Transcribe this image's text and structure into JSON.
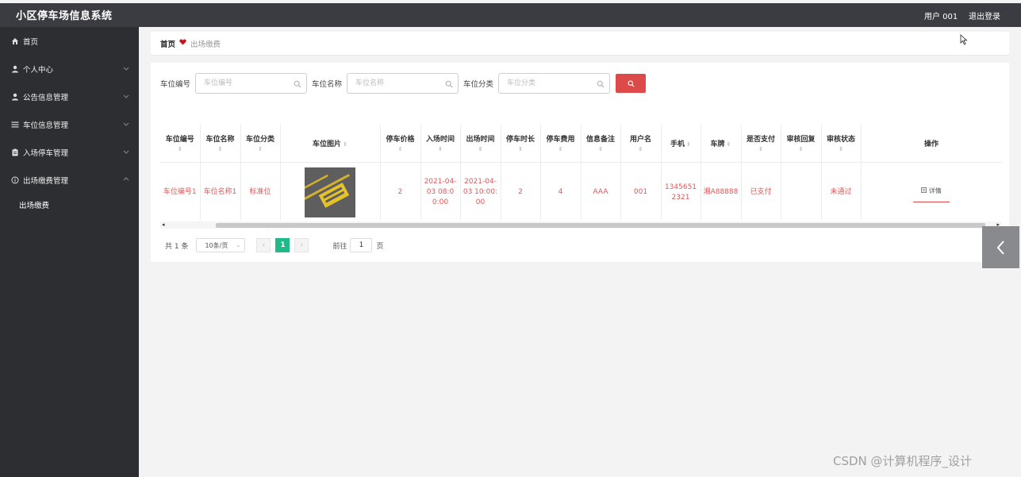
{
  "header": {
    "title": "小区停车场信息系统",
    "user": "用户 001",
    "logout": "退出登录"
  },
  "sidebar": {
    "items": [
      {
        "label": "首页",
        "icon": "home-icon"
      },
      {
        "label": "个人中心",
        "icon": "user-icon"
      },
      {
        "label": "公告信息管理",
        "icon": "user-icon"
      },
      {
        "label": "车位信息管理",
        "icon": "list-icon"
      },
      {
        "label": "入场停车管理",
        "icon": "clipboard-icon"
      },
      {
        "label": "出场缴费管理",
        "icon": "info-circle-icon",
        "expanded": true
      }
    ],
    "submenu": [
      {
        "label": "出场缴费"
      }
    ]
  },
  "breadcrumb": {
    "home": "首页",
    "current": "出场缴费"
  },
  "search": {
    "fields": [
      {
        "label": "车位编号",
        "placeholder": "车位编号"
      },
      {
        "label": "车位名称",
        "placeholder": "车位名称"
      },
      {
        "label": "车位分类",
        "placeholder": "车位分类"
      }
    ]
  },
  "table": {
    "columns": [
      "车位编号",
      "车位名称",
      "车位分类",
      "车位图片",
      "停车价格",
      "入场时间",
      "出场时间",
      "停车时长",
      "停车费用",
      "信息备注",
      "用户名",
      "手机",
      "车牌",
      "是否支付",
      "审核回复",
      "审核状态",
      "操作"
    ],
    "rows": [
      {
        "cells": [
          "车位编号1",
          "车位名称1",
          "标准位",
          "",
          "2",
          "2021-04-03 08:00:00",
          "2021-04-03 10:00:00",
          "2",
          "4",
          "AAA",
          "001",
          "13456512321",
          "湘A88888",
          "已支付",
          "",
          "未通过"
        ],
        "action": "详情"
      }
    ]
  },
  "pagination": {
    "total": "共 1 条",
    "page_size": "10条/页",
    "current": "1",
    "goto_prefix": "前往",
    "goto_value": "1",
    "goto_suffix": "页"
  },
  "watermark": "CSDN @计算机程序_设计",
  "colors": {
    "accent": "#dc4a4a",
    "page_active": "#20b98a",
    "sidebar": "#2d2e32",
    "topbar": "#3a3c42"
  }
}
